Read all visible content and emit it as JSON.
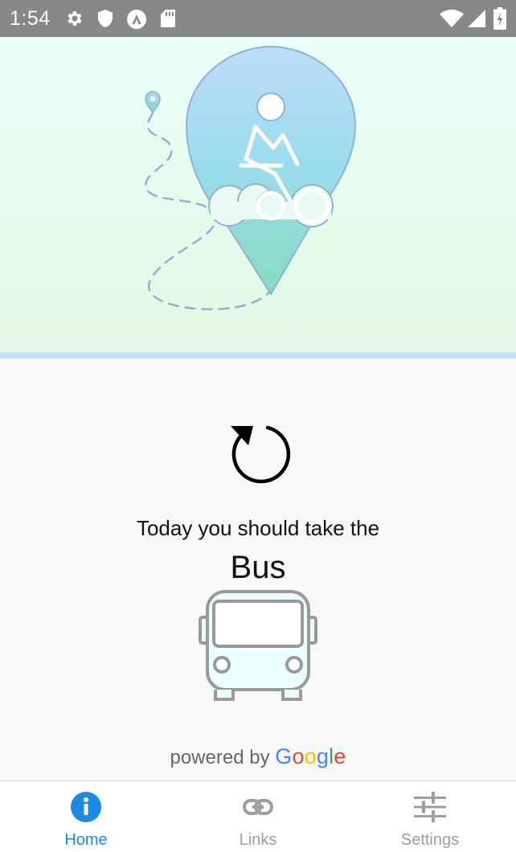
{
  "status_bar": {
    "time": "1:54",
    "left_icons": [
      "gear-icon",
      "shield-icon",
      "app-a-icon",
      "sd-card-icon"
    ],
    "right_icons": [
      "wifi-icon",
      "cell-signal-icon",
      "battery-icon"
    ]
  },
  "hero": {
    "illustration": "cyclist-in-map-pin-illustration",
    "colors": {
      "pin_top": "#b7dcf7",
      "pin_bottom": "#86dbc4",
      "path": "#8fb3cf"
    }
  },
  "main": {
    "refresh_icon": "refresh-icon",
    "prompt": "Today you should take the",
    "mode": "Bus",
    "mode_icon": "bus-icon",
    "powered_by": "powered by",
    "google_letters": [
      {
        "ch": "G",
        "color": "#4285F4"
      },
      {
        "ch": "o",
        "color": "#EA4335"
      },
      {
        "ch": "o",
        "color": "#FBBC05"
      },
      {
        "ch": "g",
        "color": "#4285F4"
      },
      {
        "ch": "l",
        "color": "#34A853"
      },
      {
        "ch": "e",
        "color": "#EA4335"
      }
    ]
  },
  "tabs": [
    {
      "label": "Home",
      "icon": "info-icon",
      "active": true
    },
    {
      "label": "Links",
      "icon": "link-icon",
      "active": false
    },
    {
      "label": "Settings",
      "icon": "sliders-icon",
      "active": false
    }
  ],
  "colors": {
    "accent": "#1e88e5",
    "inactive": "#9e9e9e",
    "status_bar": "#888888"
  }
}
